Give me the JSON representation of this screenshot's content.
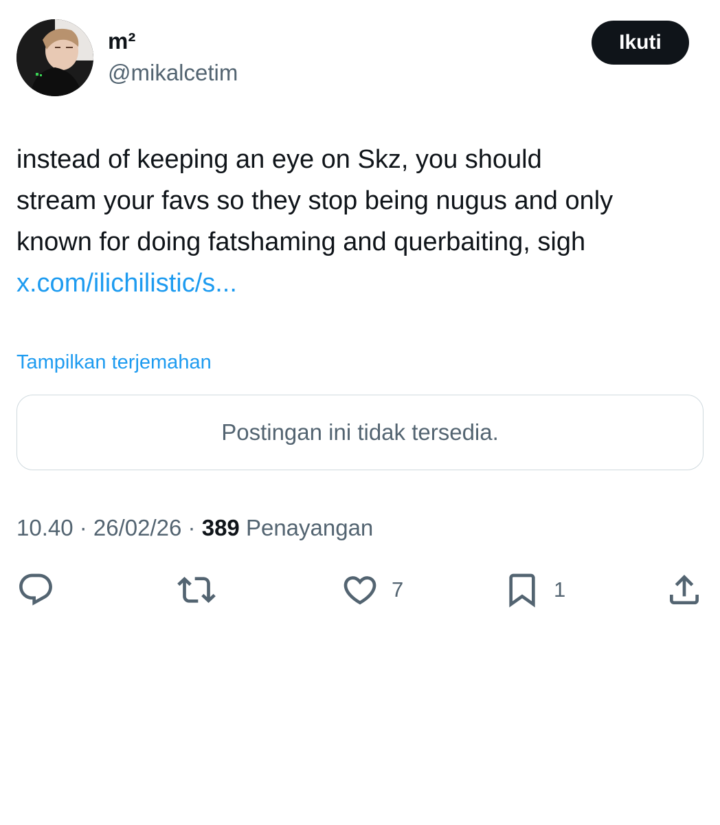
{
  "author": {
    "name": "m²",
    "handle": "@mikalcetim"
  },
  "follow_button": {
    "label": "Ikuti"
  },
  "tweet": {
    "text_lines": [
      "instead of keeping an eye on Skz, you should",
      "stream your favs so they stop being nugus and only",
      "known for doing fatshaming and querbaiting, sigh"
    ],
    "link_text": "x.com/ilichilistic/s..."
  },
  "translate": {
    "label": "Tampilkan terjemahan"
  },
  "quoted_post": {
    "message": "Postingan ini tidak tersedia."
  },
  "meta": {
    "time": "10.40",
    "separator": " · ",
    "date": "26/02/26",
    "views_count": "389",
    "views_label": "Penayangan"
  },
  "actions": {
    "reply": {
      "icon": "reply-icon",
      "count": ""
    },
    "repost": {
      "icon": "repost-icon",
      "count": ""
    },
    "like": {
      "icon": "heart-icon",
      "count": "7"
    },
    "bookmark": {
      "icon": "bookmark-icon",
      "count": "1"
    },
    "share": {
      "icon": "share-icon"
    }
  },
  "colors": {
    "text_primary": "#0f1419",
    "text_secondary": "#536471",
    "link": "#1d9bf0",
    "border": "#cfd9de",
    "button_bg": "#0f1419"
  }
}
